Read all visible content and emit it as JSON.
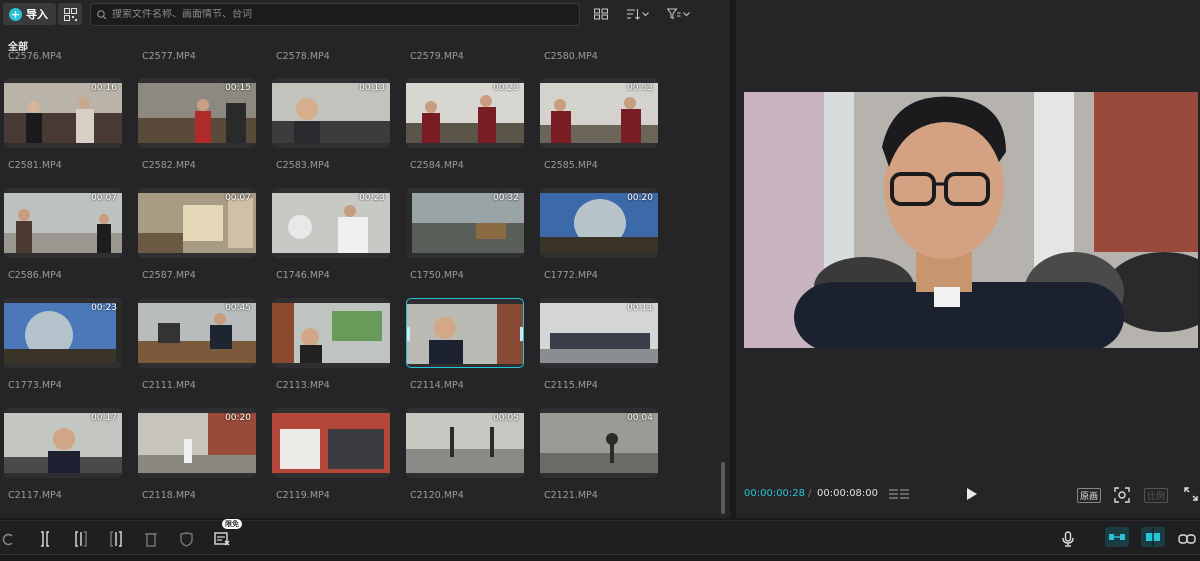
{
  "toolbar": {
    "import_label": "导入",
    "search_placeholder": "搜索文件名称、画面情节、台词"
  },
  "section_label": "全部",
  "top_names": [
    "C2576.MP4",
    "C2577.MP4",
    "C2578.MP4",
    "C2579.MP4",
    "C2580.MP4"
  ],
  "clips": [
    {
      "name": "C2581.MP4",
      "duration": "00:16"
    },
    {
      "name": "C2582.MP4",
      "duration": "00:15"
    },
    {
      "name": "C2583.MP4",
      "duration": "00:13"
    },
    {
      "name": "C2584.MP4",
      "duration": "00:23"
    },
    {
      "name": "C2585.MP4",
      "duration": "00:53"
    },
    {
      "name": "C2586.MP4",
      "duration": "00:07"
    },
    {
      "name": "C2587.MP4",
      "duration": "00:07"
    },
    {
      "name": "C1746.MP4",
      "duration": "00:23"
    },
    {
      "name": "C1750.MP4",
      "duration": "00:32"
    },
    {
      "name": "C1772.MP4",
      "duration": "00:20"
    },
    {
      "name": "C1773.MP4",
      "duration": "00:23"
    },
    {
      "name": "C2111.MP4",
      "duration": "00:45"
    },
    {
      "name": "C2113.MP4",
      "duration": ""
    },
    {
      "name": "C2114.MP4",
      "duration": ""
    },
    {
      "name": "C2115.MP4",
      "duration": "00:11"
    },
    {
      "name": "C2117.MP4",
      "duration": "00:17"
    },
    {
      "name": "C2118.MP4",
      "duration": "00:20"
    },
    {
      "name": "C2119.MP4",
      "duration": ""
    },
    {
      "name": "C2120.MP4",
      "duration": "00:05"
    },
    {
      "name": "C2121.MP4",
      "duration": "00:04"
    }
  ],
  "selected_clip": "C2114.MP4",
  "preview": {
    "current_time": "00:00:00:28",
    "separator": "/",
    "total_time": "00:00:08:00",
    "original_label": "原画",
    "ratio_label": "比例"
  },
  "bottom_bar": {
    "badge": "限免"
  },
  "colors": {
    "accent": "#26c4d4",
    "panel": "#252527",
    "background": "#1a1a1c"
  }
}
